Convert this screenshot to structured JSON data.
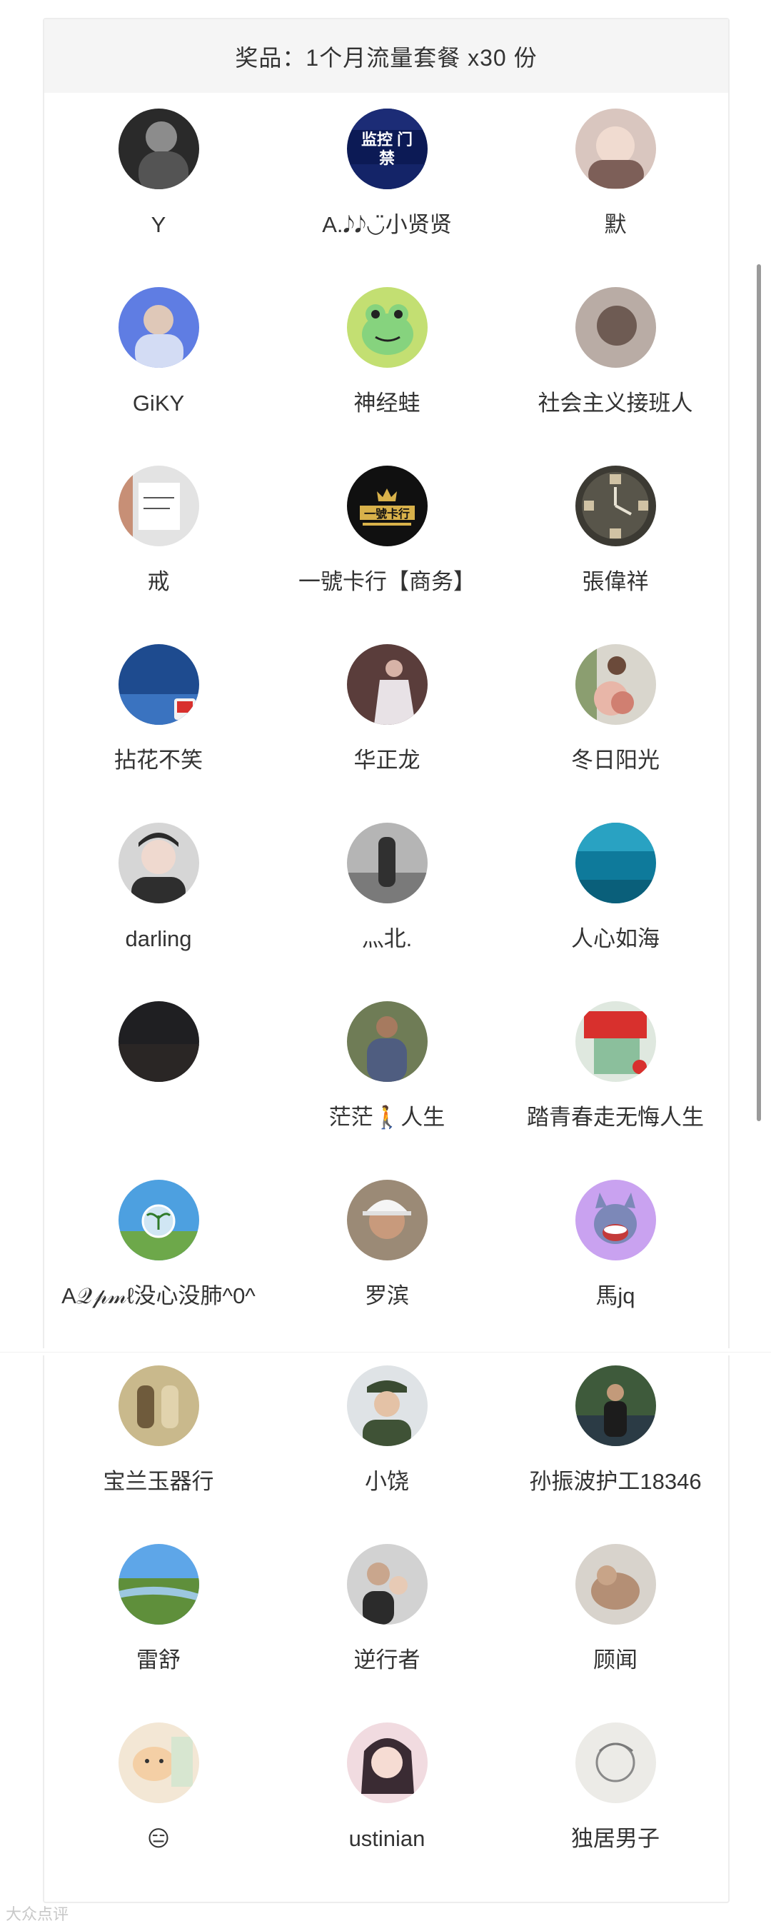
{
  "prize": {
    "text": "奖品：1个月流量套餐 x30 份"
  },
  "participants": [
    {
      "name": "Y",
      "avatar": "dark-portrait-photo"
    },
    {
      "name": "A.𝅘𝅥𝅮𝅘𝅥𝅮◡̈小贤贤",
      "avatar": "security-door-ad-logo",
      "badge": "监控 门禁"
    },
    {
      "name": "默",
      "avatar": "girl-portrait-photo"
    },
    {
      "name": "GiKY",
      "avatar": "blue-sky-portrait-photo"
    },
    {
      "name": "神经蛙",
      "avatar": "green-frog-cartoon"
    },
    {
      "name": "社会主义接班人",
      "avatar": "blurred-girl-photo"
    },
    {
      "name": "戒",
      "avatar": "handwritten-note-photo"
    },
    {
      "name": "一號卡行【商务】",
      "avatar": "gold-crown-logo",
      "badge": "一號卡行"
    },
    {
      "name": "張偉祥",
      "avatar": "photo-clock"
    },
    {
      "name": "拈花不笑",
      "avatar": "blue-sky-flag-photo"
    },
    {
      "name": "华正龙",
      "avatar": "wedding-photo"
    },
    {
      "name": "冬日阳光",
      "avatar": "bouquet-photo"
    },
    {
      "name": "darling",
      "avatar": "young-man-portrait"
    },
    {
      "name": "灬北.",
      "avatar": "street-photo"
    },
    {
      "name": "人心如海",
      "avatar": "underwater-photo"
    },
    {
      "name": "",
      "avatar": "night-sky-photo"
    },
    {
      "name": "茫茫🚶人生",
      "avatar": "man-outdoor-photo"
    },
    {
      "name": "踏青春走无悔人生",
      "avatar": "red-flag-photo"
    },
    {
      "name": "A𝒬𝓅𝓂ℓ没心没肺^0^",
      "avatar": "plant-globe-photo"
    },
    {
      "name": "罗滨",
      "avatar": "hard-hat-portrait"
    },
    {
      "name": "馬jq",
      "avatar": "cartoon-cat-laughing"
    },
    {
      "name": "宝兰玉器行",
      "avatar": "jade-items-photo"
    },
    {
      "name": "小饶",
      "avatar": "uniform-portrait"
    },
    {
      "name": "孙振波护工18346",
      "avatar": "man-by-river-photo"
    },
    {
      "name": "雷舒",
      "avatar": "landscape-photo"
    },
    {
      "name": "逆行者",
      "avatar": "man-with-child-photo"
    },
    {
      "name": "顾闻",
      "avatar": "cat-photo"
    },
    {
      "name": "😑",
      "avatar": "cartoon-cat-drawing"
    },
    {
      "name": "ustinian",
      "avatar": "anime-girl-drawing"
    },
    {
      "name": "独居男子",
      "avatar": "sketch-portrait"
    }
  ],
  "watermark": "大众点评",
  "colors": {
    "header_bg": "#f5f5f5",
    "text": "#333333",
    "border": "#ededed"
  }
}
